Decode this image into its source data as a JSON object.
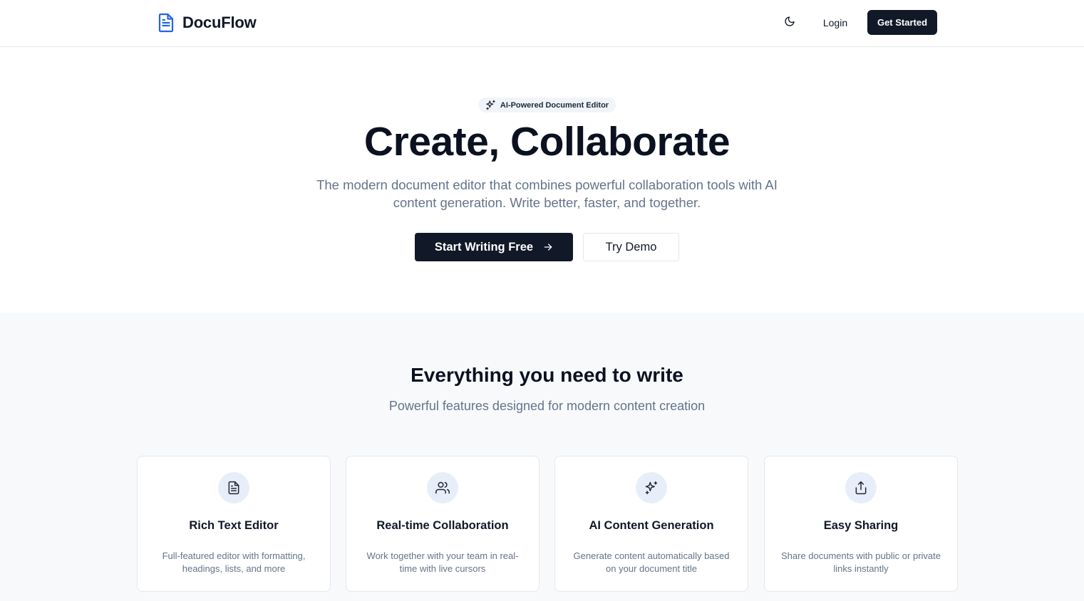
{
  "header": {
    "brand": "DocuFlow",
    "login_label": "Login",
    "cta_label": "Get Started"
  },
  "hero": {
    "badge": "AI-Powered Document Editor",
    "title": "Create, Collaborate",
    "subtitle": "The modern document editor that combines powerful collaboration tools with AI content generation. Write better, faster, and together.",
    "primary_label": "Start Writing Free",
    "secondary_label": "Try Demo"
  },
  "features": {
    "title": "Everything you need to write",
    "subtitle": "Powerful features designed for modern content creation",
    "cards": [
      {
        "icon": "document-icon",
        "title": "Rich Text Editor",
        "desc": "Full-featured editor with formatting, headings, lists, and more"
      },
      {
        "icon": "users-icon",
        "title": "Real-time Collaboration",
        "desc": "Work together with your team in real-time with live cursors"
      },
      {
        "icon": "sparkles-icon",
        "title": "AI Content Generation",
        "desc": "Generate content automatically based on your document title"
      },
      {
        "icon": "share-icon",
        "title": "Easy Sharing",
        "desc": "Share documents with public or private links instantly"
      }
    ]
  },
  "colors": {
    "brand_blue": "#2563eb",
    "dark": "#111827",
    "muted": "#64748b",
    "section_bg": "#f8f9fb",
    "icon_bg": "#e8eef9"
  }
}
